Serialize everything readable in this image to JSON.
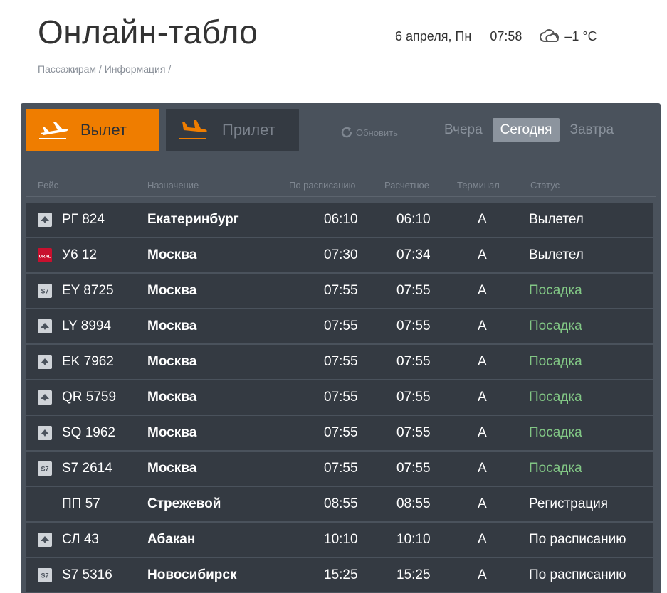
{
  "header": {
    "title": "Онлайн-табло",
    "date": "6 апреля, Пн",
    "time": "07:58",
    "weather_icon": "cloud-icon",
    "temperature": "–1 °C"
  },
  "breadcrumb": {
    "items": [
      "Пассажирам",
      "Информация"
    ],
    "separator": " / "
  },
  "direction": {
    "departure_label": "Вылет",
    "arrival_label": "Прилет",
    "active": "departure"
  },
  "refresh_label": "Обновить",
  "days": {
    "yesterday": "Вчера",
    "today": "Сегодня",
    "tomorrow": "Завтра",
    "active": "today"
  },
  "columns": {
    "flight": "Рейс",
    "destination": "Назначение",
    "scheduled": "По расписанию",
    "estimated": "Расчетное",
    "terminal": "Терминал",
    "status": "Статус"
  },
  "flights": [
    {
      "logo": "airline-logo-gray",
      "flight": "РГ 824",
      "destination": "Екатеринбург",
      "scheduled": "06:10",
      "estimated": "06:10",
      "terminal": "A",
      "status": "Вылетел",
      "status_type": "departed"
    },
    {
      "logo": "ural-airlines-logo",
      "logo_text": "URAL",
      "flight": "У6 12",
      "destination": "Москва",
      "scheduled": "07:30",
      "estimated": "07:34",
      "terminal": "A",
      "status": "Вылетел",
      "status_type": "departed"
    },
    {
      "logo": "s7-logo",
      "logo_text": "S7",
      "flight": "EY 8725",
      "destination": "Москва",
      "scheduled": "07:55",
      "estimated": "07:55",
      "terminal": "A",
      "status": "Посадка",
      "status_type": "boarding"
    },
    {
      "logo": "flag-logo",
      "flight": "LY 8994",
      "destination": "Москва",
      "scheduled": "07:55",
      "estimated": "07:55",
      "terminal": "A",
      "status": "Посадка",
      "status_type": "boarding"
    },
    {
      "logo": "emirates-logo",
      "flight": "EK 7962",
      "destination": "Москва",
      "scheduled": "07:55",
      "estimated": "07:55",
      "terminal": "A",
      "status": "Посадка",
      "status_type": "boarding"
    },
    {
      "logo": "qatar-logo",
      "flight": "QR 5759",
      "destination": "Москва",
      "scheduled": "07:55",
      "estimated": "07:55",
      "terminal": "A",
      "status": "Посадка",
      "status_type": "boarding"
    },
    {
      "logo": "singapore-logo",
      "flight": "SQ 1962",
      "destination": "Москва",
      "scheduled": "07:55",
      "estimated": "07:55",
      "terminal": "A",
      "status": "Посадка",
      "status_type": "boarding"
    },
    {
      "logo": "s7-logo",
      "logo_text": "S7",
      "flight": "S7 2614",
      "destination": "Москва",
      "scheduled": "07:55",
      "estimated": "07:55",
      "terminal": "A",
      "status": "Посадка",
      "status_type": "boarding"
    },
    {
      "logo": "",
      "flight": "ПП 57",
      "destination": "Стрежевой",
      "scheduled": "08:55",
      "estimated": "08:55",
      "terminal": "A",
      "status": "Регистрация",
      "status_type": "checkin"
    },
    {
      "logo": "siberia-light-logo",
      "flight": "СЛ 43",
      "destination": "Абакан",
      "scheduled": "10:10",
      "estimated": "10:10",
      "terminal": "A",
      "status": "По расписанию",
      "status_type": "scheduled"
    },
    {
      "logo": "s7-logo",
      "logo_text": "S7",
      "flight": "S7 5316",
      "destination": "Новосибирск",
      "scheduled": "15:25",
      "estimated": "15:25",
      "terminal": "A",
      "status": "По расписанию",
      "status_type": "scheduled"
    }
  ],
  "colors": {
    "accent": "#ef7d00",
    "board_bg": "#4a525c",
    "row_bg": "#343a42",
    "boarding_status": "#82c785"
  }
}
